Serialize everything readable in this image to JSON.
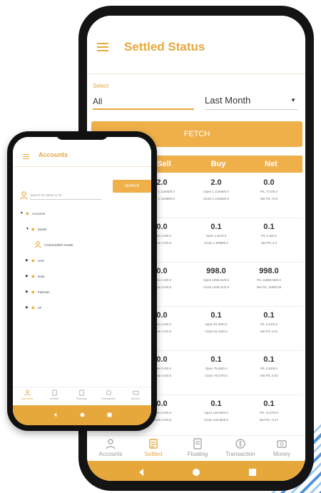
{
  "big_phone": {
    "title": "Settled Status",
    "select_label": "Select",
    "select_value": "All",
    "period": "Last Month",
    "fetch_label": "FETCH",
    "columns": [
      "Sell",
      "Buy",
      "Net"
    ],
    "rows": [
      {
        "sell": "2.0",
        "sell_sub": [
          "Open 1.11566/0.0",
          "Close 1.11586/0.0"
        ],
        "buy": "2.0",
        "buy_sub": [
          "Open 1.11566/0.0",
          "Close 1.11586/0.0"
        ],
        "net": "0.0",
        "net_sub": [
          "P/L 72.0/0.0",
          "Net P/L 72.0"
        ]
      },
      {
        "sell": "0.0",
        "sell_sub": [
          "Open 0.0/0.0",
          "Close 0.0/0.0"
        ],
        "buy": "0.1",
        "buy_sub": [
          "Open 1.81/0.0",
          "Close 1.5098/0.0"
        ],
        "net": "0.1",
        "net_sub": [
          "P/L 2.0/0.0",
          "Net P/L 2.0"
        ]
      },
      {
        "sell": "0.0",
        "sell_sub": [
          "Open 0.0/0.0",
          "Close 0.0/0.0"
        ],
        "buy": "998.0",
        "buy_sub": [
          "Open 1095.64/0.0",
          "Close 1208.01/0.0"
        ],
        "net": "998.0",
        "net_sub": [
          "P/L 11898.06/0.0",
          "Net P/L 11898.06"
        ]
      },
      {
        "sell": "0.0",
        "sell_sub": [
          "Open 0.0/0.0",
          "Close 0.0/0.0"
        ],
        "buy": "0.1",
        "buy_sub": [
          "Open 81.60/0.0",
          "Close 81.54/0.0"
        ],
        "net": "0.1",
        "net_sub": [
          "P/L 0.01/0.0",
          "Net P/L 0.01"
        ]
      },
      {
        "sell": "0.0",
        "sell_sub": [
          "Open 0.0/0.0",
          "Close 0.0/0.0"
        ],
        "buy": "0.1",
        "buy_sub": [
          "Open 75.58/0.0",
          "Close 75.57/0.0"
        ],
        "net": "0.1",
        "net_sub": [
          "P/L 0.93/0.0",
          "Net P/L 0.93"
        ]
      },
      {
        "sell": "0.0",
        "sell_sub": [
          "Open 0.0/0.0",
          "Close 0.0/0.0"
        ],
        "buy": "0.1",
        "buy_sub": [
          "Open 140.99/0.0",
          "Close 140.86/0.0"
        ],
        "net": "0.1",
        "net_sub": [
          "P/L -0.27/0.0",
          "Net P/L -0.27"
        ]
      }
    ],
    "tabs": [
      "Accounts",
      "Settled",
      "Floating",
      "Transaction",
      "Money"
    ]
  },
  "small_phone": {
    "title": "Accounts",
    "search_placeholder": "Search by Name or ID",
    "search_button": "SEARCH",
    "tree": [
      "Accounts",
      "Dealer",
      "CONSUMER NAME",
      "UAE",
      "India",
      "Pakistan",
      "UF"
    ],
    "tabs": [
      "Accounts",
      "Settled",
      "Floating",
      "Transaction",
      "Money"
    ]
  },
  "colors": {
    "accent": "#e7a83b",
    "accent_light": "#efb04a",
    "frame": "#141414"
  }
}
